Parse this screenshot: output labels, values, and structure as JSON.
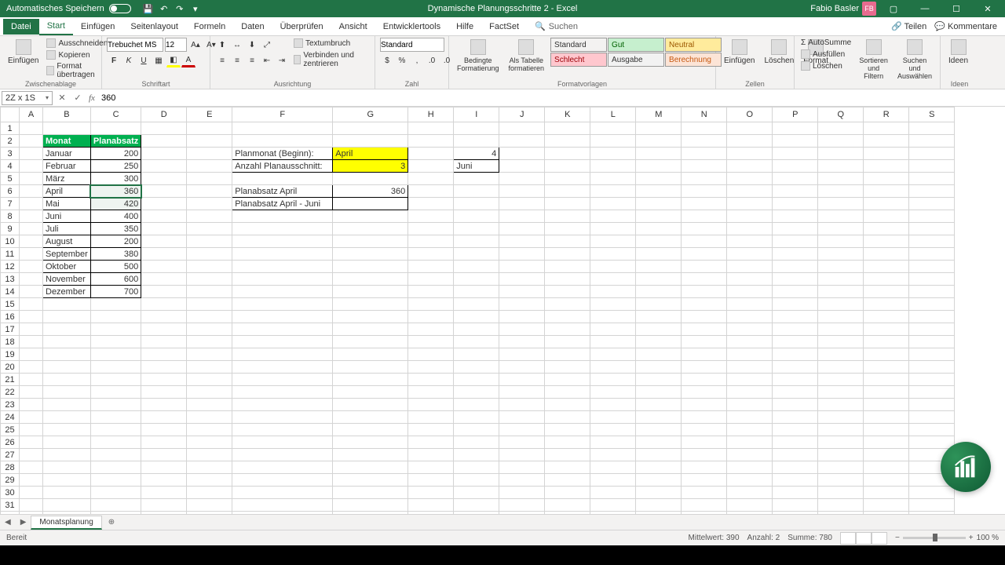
{
  "titlebar": {
    "autosave": "Automatisches Speichern",
    "doc_title": "Dynamische Planungsschritte 2 - Excel",
    "user": "Fabio Basler",
    "avatar_initials": "FB"
  },
  "menu": {
    "file": "Datei",
    "start": "Start",
    "einfuegen": "Einfügen",
    "seitenlayout": "Seitenlayout",
    "formeln": "Formeln",
    "daten": "Daten",
    "ueberpruefen": "Überprüfen",
    "ansicht": "Ansicht",
    "entwickler": "Entwicklertools",
    "hilfe": "Hilfe",
    "factset": "FactSet",
    "suchen": "Suchen",
    "teilen": "Teilen",
    "kommentare": "Kommentare"
  },
  "ribbon": {
    "clipboard": {
      "paste": "Einfügen",
      "cut": "Ausschneiden",
      "copy": "Kopieren",
      "format_painter": "Format übertragen",
      "label": "Zwischenablage"
    },
    "font": {
      "name": "Trebuchet MS",
      "size": "12",
      "label": "Schriftart"
    },
    "align": {
      "wrap": "Textumbruch",
      "merge": "Verbinden und zentrieren",
      "label": "Ausrichtung"
    },
    "number": {
      "format": "Standard",
      "label": "Zahl"
    },
    "styles": {
      "cond": "Bedingte Formatierung",
      "astable": "Als Tabelle formatieren",
      "s1": "Standard",
      "s2": "Gut",
      "s3": "Neutral",
      "s4": "Schlecht",
      "s5": "Ausgabe",
      "s6": "Berechnung",
      "label": "Formatvorlagen"
    },
    "cells": {
      "insert": "Einfügen",
      "delete": "Löschen",
      "format": "Format",
      "label": "Zellen"
    },
    "editing": {
      "sum": "AutoSumme",
      "fill": "Ausfüllen",
      "clear": "Löschen",
      "sort": "Sortieren und Filtern",
      "find": "Suchen und Auswählen",
      "label": ""
    },
    "ideas": {
      "label": "Ideen",
      "btn": "Ideen"
    }
  },
  "formula_bar": {
    "name": "2Z x 1S",
    "value": "360"
  },
  "columns": [
    "A",
    "B",
    "C",
    "D",
    "E",
    "F",
    "G",
    "H",
    "I",
    "J",
    "K",
    "L",
    "M",
    "N",
    "O",
    "P",
    "Q",
    "R",
    "S"
  ],
  "rows": 32,
  "table": {
    "header": {
      "monat": "Monat",
      "planabsatz": "Planabsatz"
    },
    "data": [
      {
        "m": "Januar",
        "v": "200"
      },
      {
        "m": "Februar",
        "v": "250"
      },
      {
        "m": "März",
        "v": "300"
      },
      {
        "m": "April",
        "v": "360"
      },
      {
        "m": "Mai",
        "v": "420"
      },
      {
        "m": "Juni",
        "v": "400"
      },
      {
        "m": "Juli",
        "v": "350"
      },
      {
        "m": "August",
        "v": "200"
      },
      {
        "m": "September",
        "v": "380"
      },
      {
        "m": "Oktober",
        "v": "500"
      },
      {
        "m": "November",
        "v": "600"
      },
      {
        "m": "Dezember",
        "v": "700"
      }
    ]
  },
  "side": {
    "planmonat_lbl": "Planmonat (Beginn):",
    "planmonat_val": "April",
    "anzahl_lbl": "Anzahl Planausschnitt:",
    "anzahl_val": "3",
    "pa_april_lbl": "Planabsatz April",
    "pa_april_val": "360",
    "pa_range_lbl": "Planabsatz April - Juni",
    "pa_range_val": "",
    "i3": "4",
    "i4": "Juni"
  },
  "sheet": {
    "name": "Monatsplanung"
  },
  "status": {
    "ready": "Bereit",
    "mittel": "Mittelwert: 390",
    "anzahl": "Anzahl: 2",
    "summe": "Summe: 780",
    "zoom": "100 %"
  }
}
